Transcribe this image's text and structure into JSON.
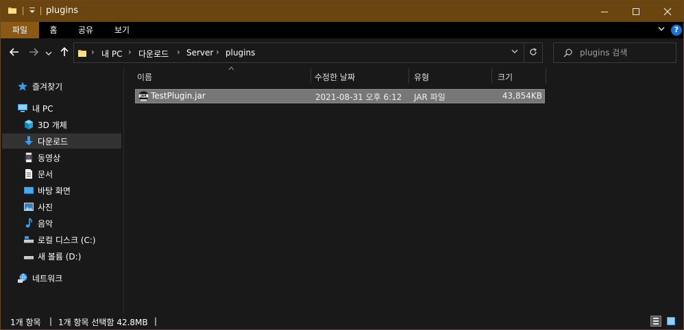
{
  "window": {
    "title": "plugins",
    "qa_icon": "dropdown-icon",
    "buttons": {
      "minimize": "—",
      "maximize": "☐",
      "close": "✕"
    }
  },
  "ribbon": {
    "tabs": [
      {
        "label": "파일",
        "active": true
      },
      {
        "label": "홈",
        "active": false
      },
      {
        "label": "공유",
        "active": false
      },
      {
        "label": "보기",
        "active": false
      }
    ],
    "help": "?"
  },
  "address": {
    "crumbs": [
      "내 PC",
      "다운로드",
      "Server",
      "plugins"
    ]
  },
  "search": {
    "placeholder": "plugins 검색"
  },
  "sidebar": {
    "items": [
      {
        "label": "즐겨찾기",
        "icon": "star-icon"
      },
      {
        "label": "내 PC",
        "icon": "computer-icon"
      },
      {
        "label": "3D 개체",
        "icon": "cube-icon"
      },
      {
        "label": "다운로드",
        "icon": "download-icon",
        "selected": true
      },
      {
        "label": "동영상",
        "icon": "video-icon"
      },
      {
        "label": "문서",
        "icon": "document-icon"
      },
      {
        "label": "바탕 화면",
        "icon": "desktop-icon"
      },
      {
        "label": "사진",
        "icon": "picture-icon"
      },
      {
        "label": "음악",
        "icon": "music-icon"
      },
      {
        "label": "로컬 디스크 (C:)",
        "icon": "drive-icon"
      },
      {
        "label": "새 볼륨 (D:)",
        "icon": "drive-icon"
      },
      {
        "label": "네트워크",
        "icon": "network-icon"
      }
    ]
  },
  "filelist": {
    "columns": [
      "이름",
      "수정한 날짜",
      "유형",
      "크기"
    ],
    "rows": [
      {
        "name": "TestPlugin.jar",
        "modified": "2021-08-31 오후 6:12",
        "type": "JAR 파일",
        "size": "43,854KB"
      }
    ]
  },
  "status": {
    "count": "1개 항목",
    "selection": "1개 항목 선택함 42.8MB",
    "sep": "|"
  },
  "colors": {
    "title_bar": "#6b4510",
    "active_tab": "#8a5a15",
    "selected_row": "#777777",
    "accent_blue": "#1a73d1"
  }
}
